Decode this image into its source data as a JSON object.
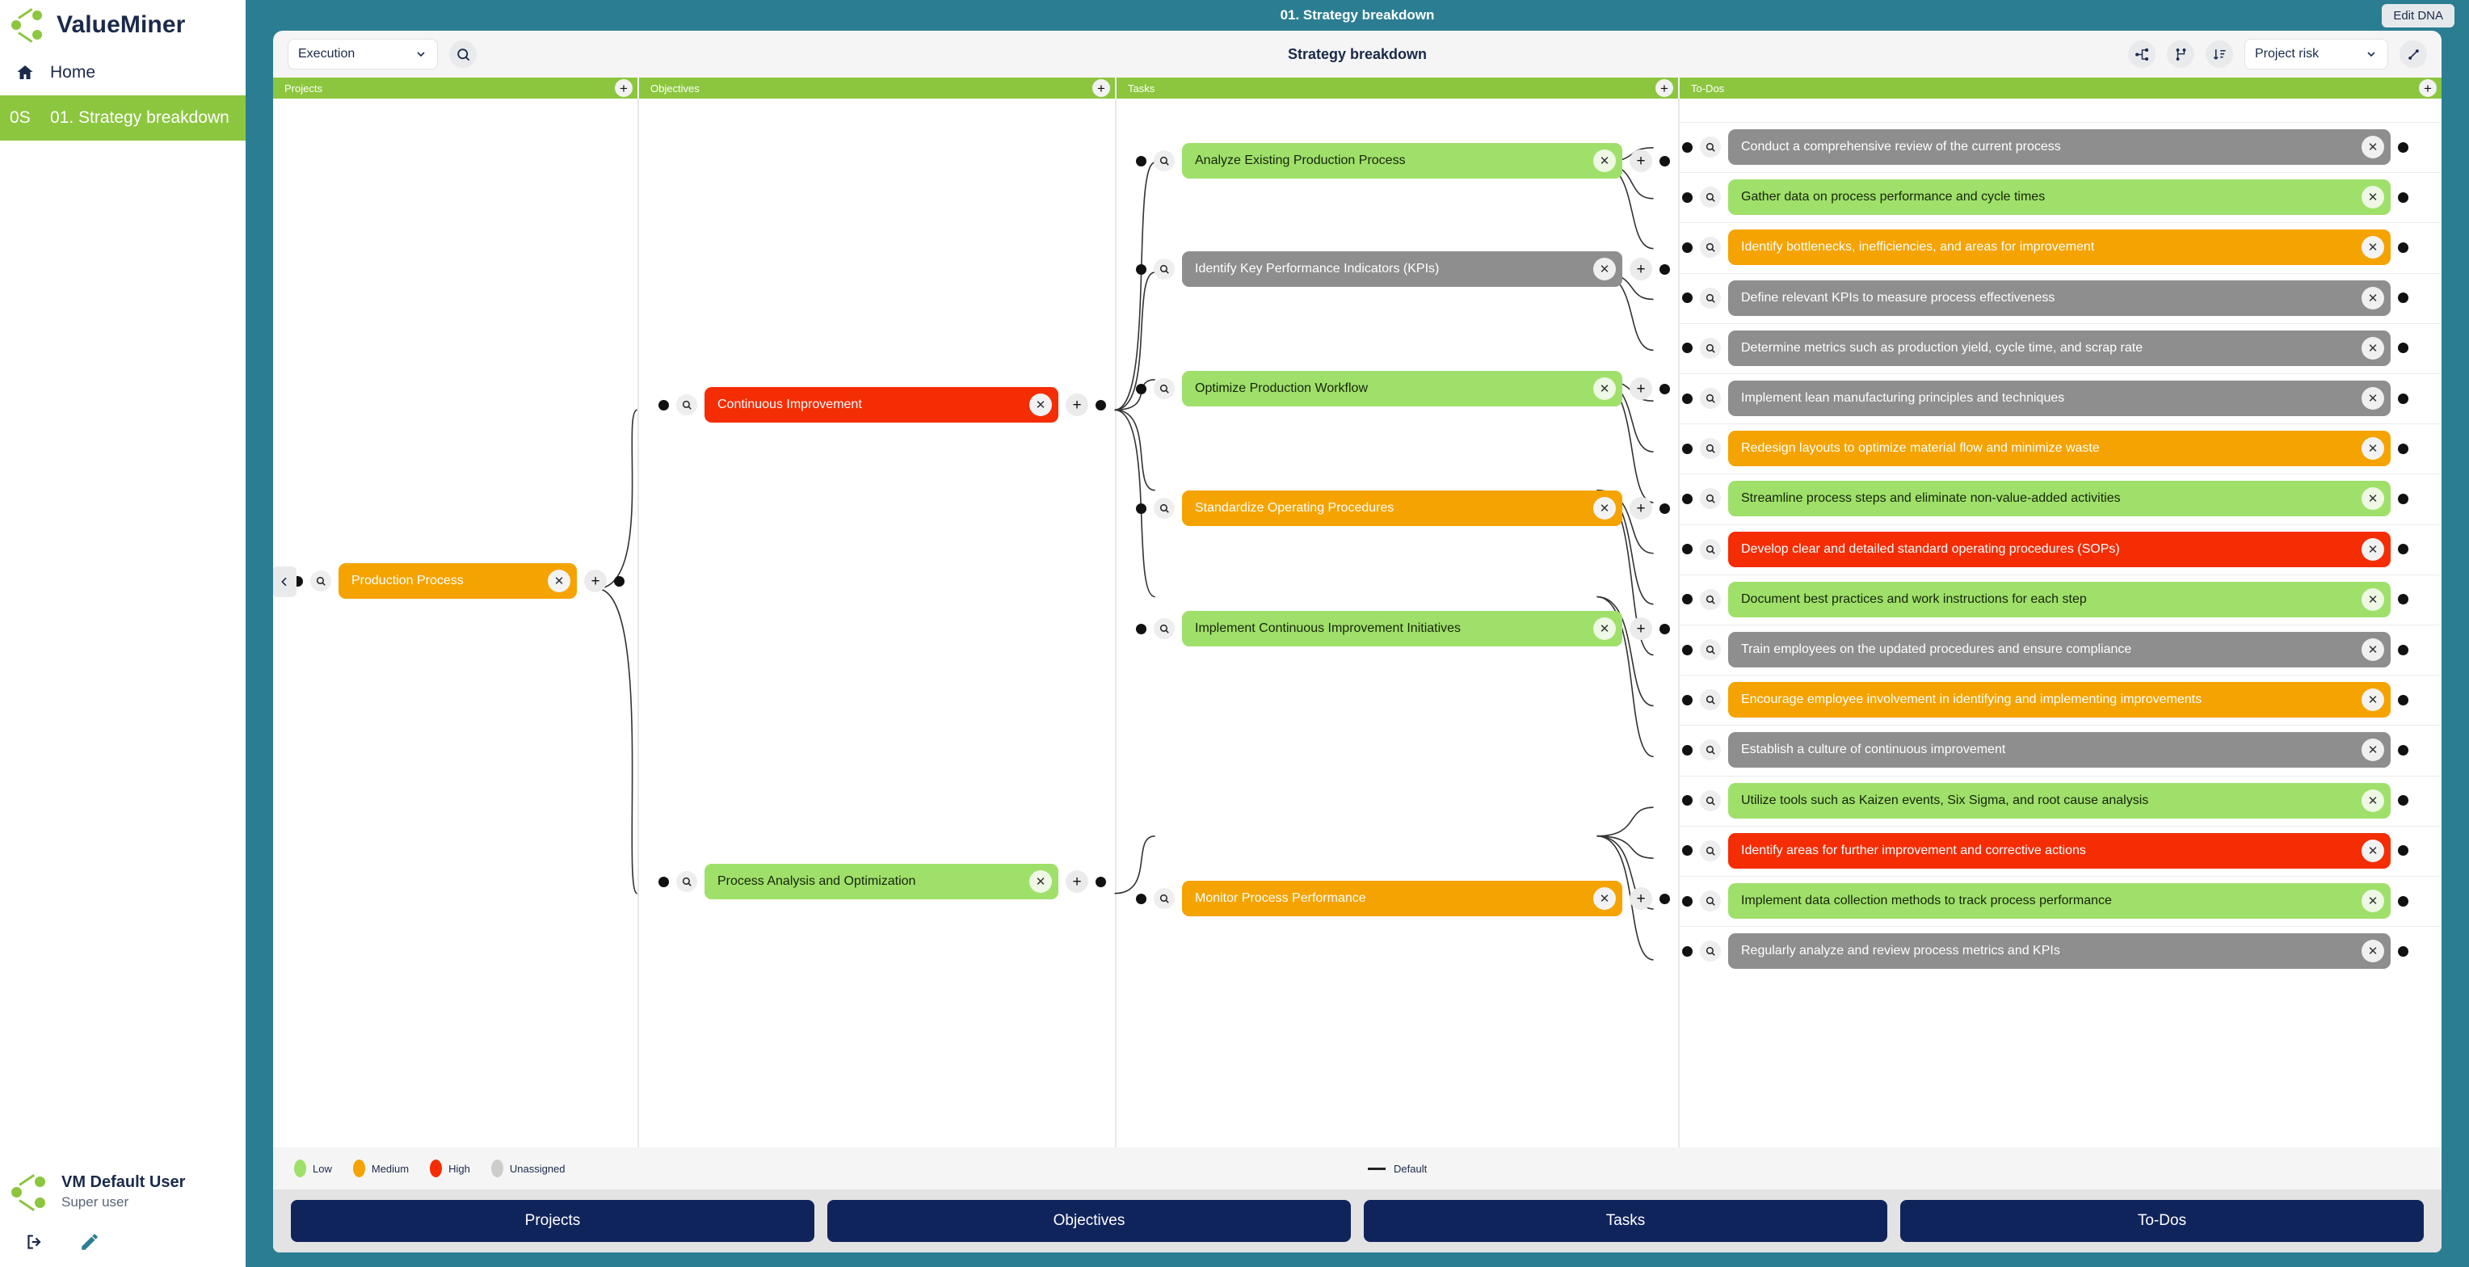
{
  "app": {
    "brand": "ValueMiner",
    "window_title": "01. Strategy breakdown",
    "edit_dna_label": "Edit DNA"
  },
  "sidebar": {
    "items": [
      {
        "code": "",
        "label": "Home",
        "icon": "home-icon",
        "active": false
      },
      {
        "code": "0S",
        "label": "01. Strategy breakdown",
        "icon": "",
        "active": true
      }
    ],
    "user": {
      "name": "VM Default User",
      "role": "Super user"
    },
    "bottom_icons": [
      "logout-icon",
      "edit-pencil-icon"
    ]
  },
  "toolbar": {
    "view_select": "Execution",
    "search_icon": "search-icon",
    "title": "Strategy breakdown",
    "right_icons": [
      "tree-layout-icon",
      "branch-layout-icon",
      "sort-icon"
    ],
    "risk_select": "Project risk",
    "expand_icon": "expand-icon"
  },
  "columns": [
    {
      "key": "projects",
      "title": "Projects"
    },
    {
      "key": "objectives",
      "title": "Objectives"
    },
    {
      "key": "tasks",
      "title": "Tasks"
    },
    {
      "key": "todos",
      "title": "To-Dos"
    }
  ],
  "nodes": {
    "projects": [
      {
        "label": "Production Process",
        "risk": "medium"
      }
    ],
    "objectives": [
      {
        "label": "Continuous Improvement",
        "risk": "high"
      },
      {
        "label": "Process Analysis and Optimization",
        "risk": "low"
      }
    ],
    "tasks": [
      {
        "label": "Analyze Existing Production Process",
        "risk": "low"
      },
      {
        "label": "Identify Key Performance Indicators (KPIs)",
        "risk": "unassigned"
      },
      {
        "label": "Optimize Production Workflow",
        "risk": "low"
      },
      {
        "label": "Standardize Operating Procedures",
        "risk": "medium"
      },
      {
        "label": "Implement Continuous Improvement Initiatives",
        "risk": "low"
      },
      {
        "label": "Monitor Process Performance",
        "risk": "medium"
      }
    ],
    "todos": [
      {
        "label": "Conduct a comprehensive review of the current process",
        "risk": "unassigned"
      },
      {
        "label": "Gather data on process performance and cycle times",
        "risk": "low"
      },
      {
        "label": "Identify bottlenecks, inefficiencies, and areas for improvement",
        "risk": "medium"
      },
      {
        "label": "Define relevant KPIs to measure process effectiveness",
        "risk": "unassigned"
      },
      {
        "label": "Determine metrics such as production yield, cycle time, and scrap rate",
        "risk": "unassigned"
      },
      {
        "label": "Implement lean manufacturing principles and techniques",
        "risk": "unassigned"
      },
      {
        "label": "Redesign layouts to optimize material flow and minimize waste",
        "risk": "medium"
      },
      {
        "label": "Streamline process steps and eliminate non-value-added activities",
        "risk": "low"
      },
      {
        "label": "Develop clear and detailed standard operating procedures (SOPs)",
        "risk": "high"
      },
      {
        "label": "Document best practices and work instructions for each step",
        "risk": "low"
      },
      {
        "label": "Train employees on the updated procedures and ensure compliance",
        "risk": "unassigned"
      },
      {
        "label": "Encourage employee involvement in identifying and implementing improvements",
        "risk": "medium"
      },
      {
        "label": "Establish a culture of continuous improvement",
        "risk": "unassigned"
      },
      {
        "label": "Utilize tools such as Kaizen events, Six Sigma, and root cause analysis",
        "risk": "low"
      },
      {
        "label": "Identify areas for further improvement and corrective actions",
        "risk": "high"
      },
      {
        "label": "Implement data collection methods to track process performance",
        "risk": "low"
      },
      {
        "label": "Regularly analyze and review process metrics and KPIs",
        "risk": "unassigned"
      }
    ]
  },
  "legend": {
    "items": [
      {
        "label": "Low",
        "color": "#9fe06a"
      },
      {
        "label": "Medium",
        "color": "#f5a300"
      },
      {
        "label": "High",
        "color": "#f52d05"
      },
      {
        "label": "Unassigned",
        "color": "#cccccc"
      }
    ],
    "line_label": "Default"
  },
  "footer_tabs": [
    {
      "label": "Projects"
    },
    {
      "label": "Objectives"
    },
    {
      "label": "Tasks"
    },
    {
      "label": "To-Dos"
    }
  ],
  "colors": {
    "brand_teal": "#2b7e92",
    "brand_green": "#8cc63e",
    "navy": "#10245c"
  }
}
